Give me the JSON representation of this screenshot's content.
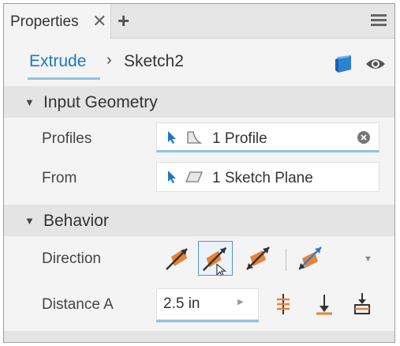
{
  "panel": {
    "tab_label": "Properties",
    "close_glyph": "✕",
    "add_glyph": "+",
    "menu_icon": "hamburger-menu-icon"
  },
  "breadcrumb": {
    "link": "Extrude",
    "separator": "›",
    "current": "Sketch2",
    "icons": [
      "cube-icon",
      "eye-icon"
    ]
  },
  "input_geometry": {
    "title": "Input Geometry",
    "profiles_label": "Profiles",
    "profiles_value": "1 Profile",
    "from_label": "From",
    "from_value": "1 Sketch Plane"
  },
  "behavior": {
    "title": "Behavior",
    "direction_label": "Direction",
    "direction_options": [
      "direction-default-icon",
      "direction-flipped-icon",
      "direction-symmetric-icon",
      "direction-asymmetric-icon"
    ],
    "selected_direction": "direction-flipped-icon",
    "distance_label": "Distance A",
    "distance_value": "2.5 in"
  },
  "colors": {
    "accent": "#1a78c2",
    "highlight": "#8ec3e8",
    "orange": "#e8823a",
    "icon_blue": "#2f7fd3"
  }
}
